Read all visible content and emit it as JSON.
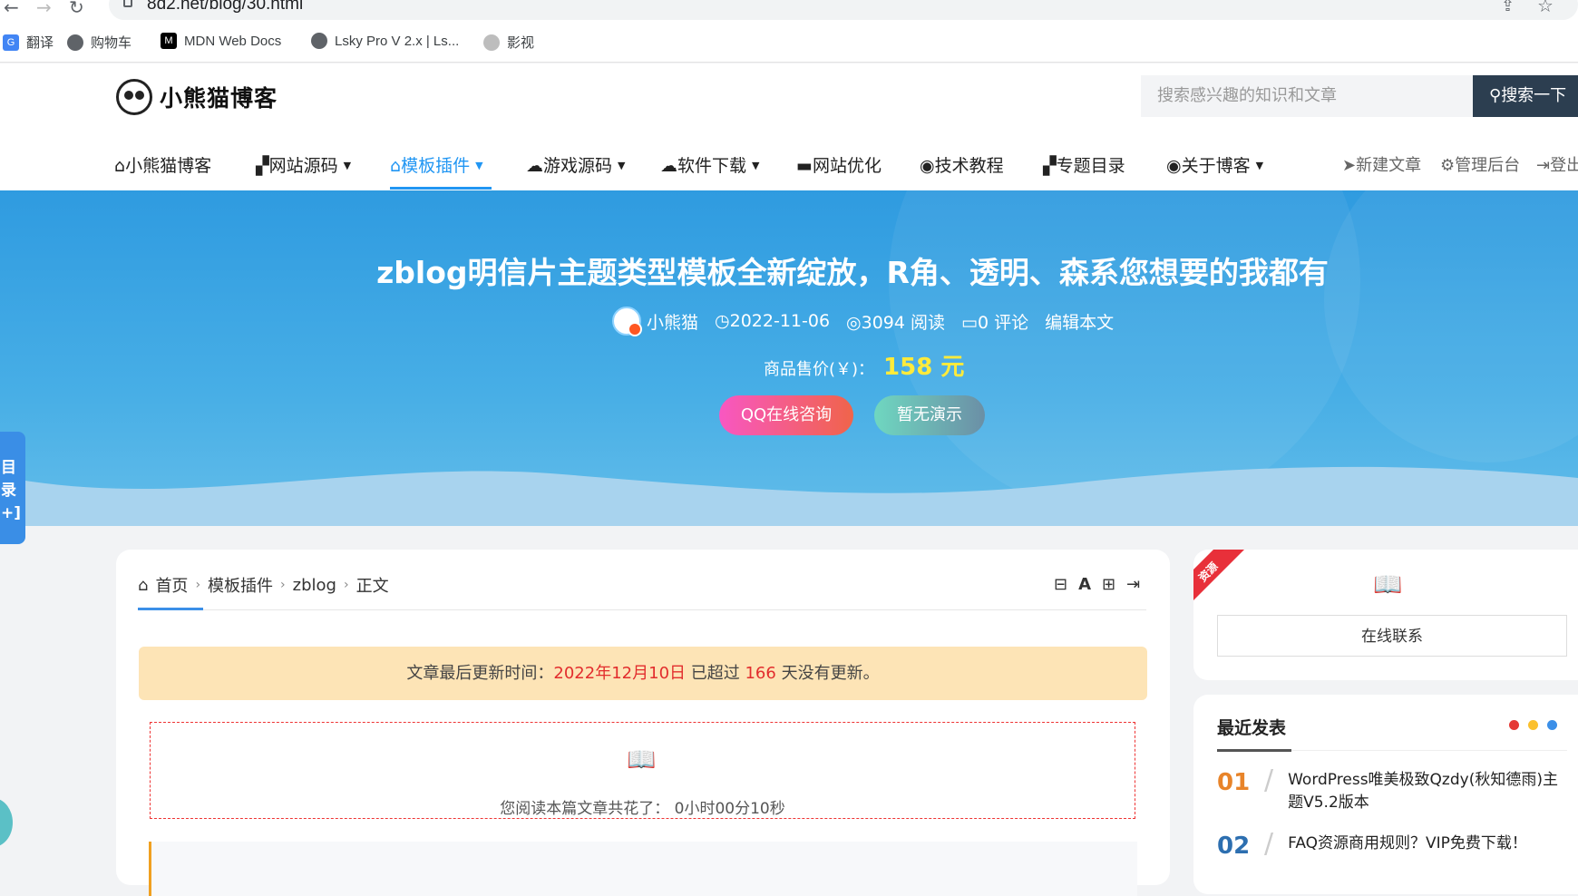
{
  "browser": {
    "url": "8d2.net/blog/30.html",
    "bookmarks": [
      {
        "label": "翻译",
        "icon": "translate-icon",
        "color": "#4285f4"
      },
      {
        "label": "购物车",
        "icon": "globe-icon",
        "color": "#5f6368"
      },
      {
        "label": "MDN Web Docs",
        "icon": "mdn-icon",
        "color": "#000000"
      },
      {
        "label": "Lsky Pro V 2.x | Ls...",
        "icon": "globe-icon",
        "color": "#5f6368"
      },
      {
        "label": "影视",
        "icon": "film-icon",
        "color": "#9e9e9e"
      }
    ]
  },
  "site": {
    "logo_text": "小熊猫博客",
    "search_placeholder": "搜索感兴趣的知识和文章",
    "search_button": "搜索一下",
    "menu": [
      {
        "label": "小熊猫博客",
        "icon": "home-icon",
        "has_caret": false
      },
      {
        "label": "网站源码",
        "icon": "windows-icon",
        "has_caret": true
      },
      {
        "label": "模板插件",
        "icon": "home-icon",
        "has_caret": true,
        "active": true
      },
      {
        "label": "游戏源码",
        "icon": "cloud-icon",
        "has_caret": true
      },
      {
        "label": "软件下载",
        "icon": "cloud-icon",
        "has_caret": true
      },
      {
        "label": "网站优化",
        "icon": "coffee-icon",
        "has_caret": false
      },
      {
        "label": "技术教程",
        "icon": "globe-icon",
        "has_caret": false
      },
      {
        "label": "专题目录",
        "icon": "windows-icon",
        "has_caret": false
      },
      {
        "label": "关于博客",
        "icon": "globe-icon",
        "has_caret": true
      }
    ],
    "menu_right": [
      {
        "label": "新建文章",
        "icon": "send-icon"
      },
      {
        "label": "管理后台",
        "icon": "gear-icon"
      },
      {
        "label": "登出",
        "icon": "logout-icon"
      }
    ]
  },
  "hero": {
    "title": "zblog明信片主题类型模板全新绽放，R角、透明、森系您想要的我都有",
    "author": "小熊猫",
    "date": "2022-11-06",
    "views": "3094 阅读",
    "comments": "0 评论",
    "edit": "编辑本文",
    "price_label": "商品售价(￥)：",
    "price_value": "158 元",
    "btn_qq": "QQ在线咨询",
    "btn_demo": "暂无演示",
    "accent_color": "#2f9be0"
  },
  "toc": {
    "chars": [
      "目",
      "录",
      "+]"
    ]
  },
  "article": {
    "breadcrumb": [
      "首页",
      "模板插件",
      "zblog",
      "正文"
    ],
    "tools": [
      "⊟",
      "A",
      "⊞",
      "⇥"
    ],
    "notice_prefix": "文章最后更新时间：",
    "notice_date": "2022年12月10日",
    "notice_mid": " 已超过 ",
    "notice_days": "166",
    "notice_suffix": " 天没有更新。",
    "read_time": "您阅读本篇文章共花了： 0小时00分10秒"
  },
  "sidebar": {
    "ribbon": "资源",
    "contact": "在线联系",
    "recent_title": "最近发表",
    "dot_colors": [
      "#e53935",
      "#fbc02d",
      "#3b8fe8"
    ],
    "posts": [
      {
        "num": "01",
        "title": "WordPress唯美极致Qzdy(秋知德雨)主题V5.2版本",
        "color": "#e8842a"
      },
      {
        "num": "02",
        "title": "FAQ资源商用规则？VIP免费下载！",
        "color": "#2d6fb0"
      }
    ]
  }
}
